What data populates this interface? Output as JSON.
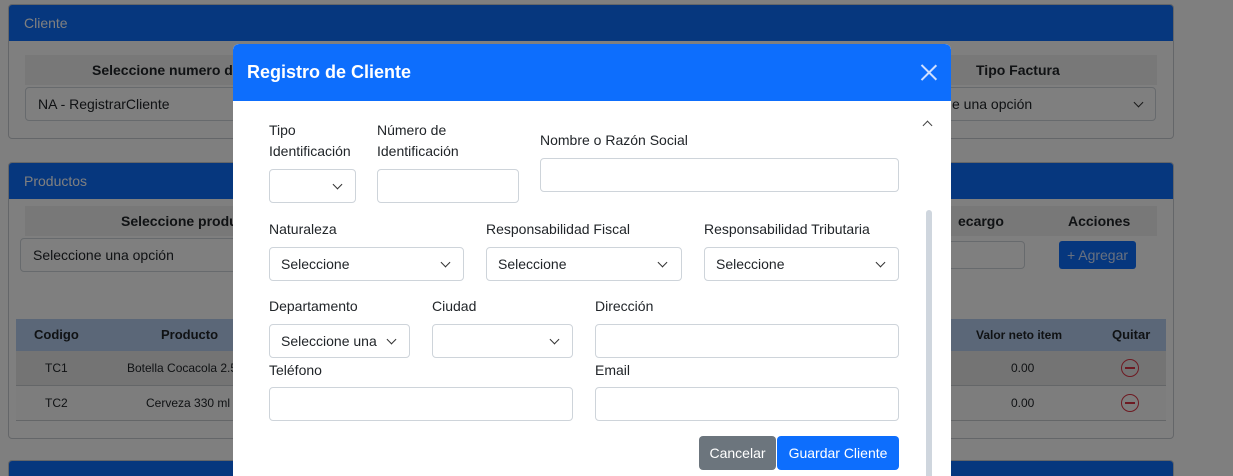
{
  "background": {
    "cliente_card": {
      "title": "Cliente",
      "col_numero": "Seleccione numero d",
      "col_tipo_factura": "Tipo Factura",
      "numero_value": "NA - RegistrarCliente",
      "tipo_factura_value": "e una opción"
    },
    "productos_card": {
      "title": "Productos",
      "col_producto": "Seleccione produ",
      "col_recargo": "ecargo",
      "col_acciones": "Acciones",
      "producto_placeholder": "Seleccione una opción",
      "add_button": "+ Agregar",
      "table": {
        "headers": {
          "codigo": "Codigo",
          "producto": "Producto",
          "valor": "Valor neto item",
          "quitar": "Quitar"
        },
        "rows": [
          {
            "codigo": "TC1",
            "producto": "Botella Cocacola 2.5",
            "valor": "0.00"
          },
          {
            "codigo": "TC2",
            "producto": "Cerveza 330 ml",
            "valor": "0.00"
          }
        ]
      }
    }
  },
  "modal": {
    "title": "Registro de Cliente",
    "labels": {
      "tipo_id_line1": "Tipo",
      "tipo_id_line2": "Identificación",
      "numero_id_line1": "Número de",
      "numero_id_line2": "Identificación",
      "nombre": "Nombre o Razón Social",
      "naturaleza": "Naturaleza",
      "resp_fiscal": "Responsabilidad Fiscal",
      "resp_tributaria": "Responsabilidad Tributaria",
      "departamento": "Departamento",
      "ciudad": "Ciudad",
      "direccion": "Dirección",
      "telefono": "Teléfono",
      "email": "Email"
    },
    "values": {
      "tipo_id": "",
      "numero_id": "",
      "nombre": "",
      "naturaleza": "Seleccione",
      "resp_fiscal": "Seleccione",
      "resp_tributaria": "Seleccione",
      "departamento": "Seleccione una",
      "ciudad": "",
      "direccion": "",
      "telefono": "",
      "email": ""
    },
    "buttons": {
      "cancel": "Cancelar",
      "save": "Guardar Cliente"
    }
  }
}
